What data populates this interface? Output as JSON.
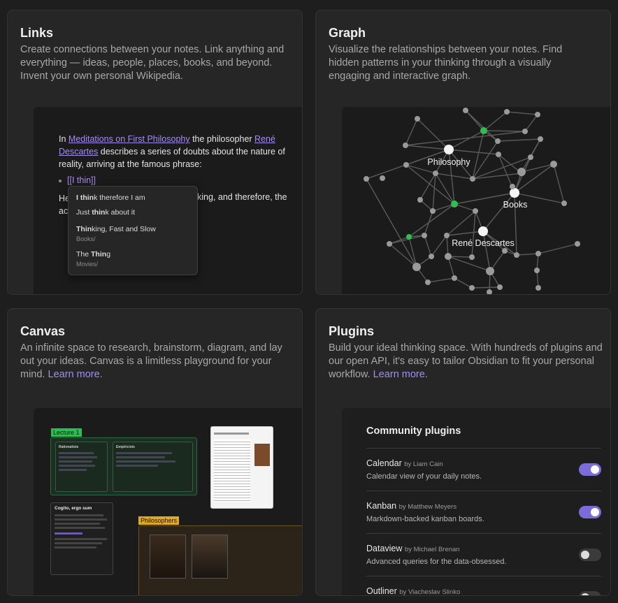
{
  "links": {
    "title": "Links",
    "desc": "Create connections between your notes. Link anything and everything — ideas, people, places, books, and beyond. Invent your own personal Wikipedia.",
    "sample": {
      "pre": "In ",
      "link1": "Meditations on First Philosophy",
      "mid": " the philosopher ",
      "link2": "René Descartes",
      "post": " describes a series of doubts about the nature of reality, arriving at the famous phrase:",
      "typed": "[[I thin]]",
      "behind_start": "He",
      "behind_end": "king, and therefore, the",
      "behind_line2": "ac"
    },
    "suggestions": [
      {
        "bold": "I thin",
        "rest": "k therefore I am",
        "sub": ""
      },
      {
        "pre": "Just ",
        "bold": "thin",
        "rest": "k about it",
        "sub": ""
      },
      {
        "bold": "Thin",
        "rest": "king, Fast and Slow",
        "sub": "Books/"
      },
      {
        "pre": "The ",
        "bold": "Thin",
        "rest": "g",
        "sub": "Movies/"
      }
    ]
  },
  "graph": {
    "title": "Graph",
    "desc": "Visualize the relationships between your notes. Find hidden patterns in your thinking through a visually engaging and interactive graph.",
    "labels": [
      "Philosophy",
      "Books",
      "René Descartes"
    ]
  },
  "canvas": {
    "title": "Canvas",
    "desc": "An infinite space to research, brainstorm, diagram, and lay out your ideas. Canvas is a limitless playground for your mind. ",
    "learn_more": "Learn more.",
    "lecture_label": "Lecture 1",
    "philosophers_label": "Philosophers",
    "rationalists": "Rationalists",
    "empiricists": "Empiricists",
    "cogito_title": "Cogito, ergo sum"
  },
  "plugins": {
    "title": "Plugins",
    "desc": "Build your ideal thinking space. With hundreds of plugins and our open API, it's easy to tailor Obsidian to fit your personal workflow. ",
    "learn_more": "Learn more.",
    "panel_title": "Community plugins",
    "items": [
      {
        "name": "Calendar",
        "author": "by Liam Cain",
        "desc": "Calendar view of your daily notes.",
        "enabled": true
      },
      {
        "name": "Kanban",
        "author": "by Matthew Meyers",
        "desc": "Markdown-backed kanban boards.",
        "enabled": true
      },
      {
        "name": "Dataview",
        "author": "by Michael Brenan",
        "desc": "Advanced queries for the data-obsessed.",
        "enabled": false
      },
      {
        "name": "Outliner",
        "author": "by Viacheslav Slinko",
        "desc": "",
        "enabled": false
      }
    ]
  },
  "colors": {
    "accent": "#a58cf0",
    "toggle_on": "#7b6cd9",
    "graph_green": "#2fbf4f"
  }
}
